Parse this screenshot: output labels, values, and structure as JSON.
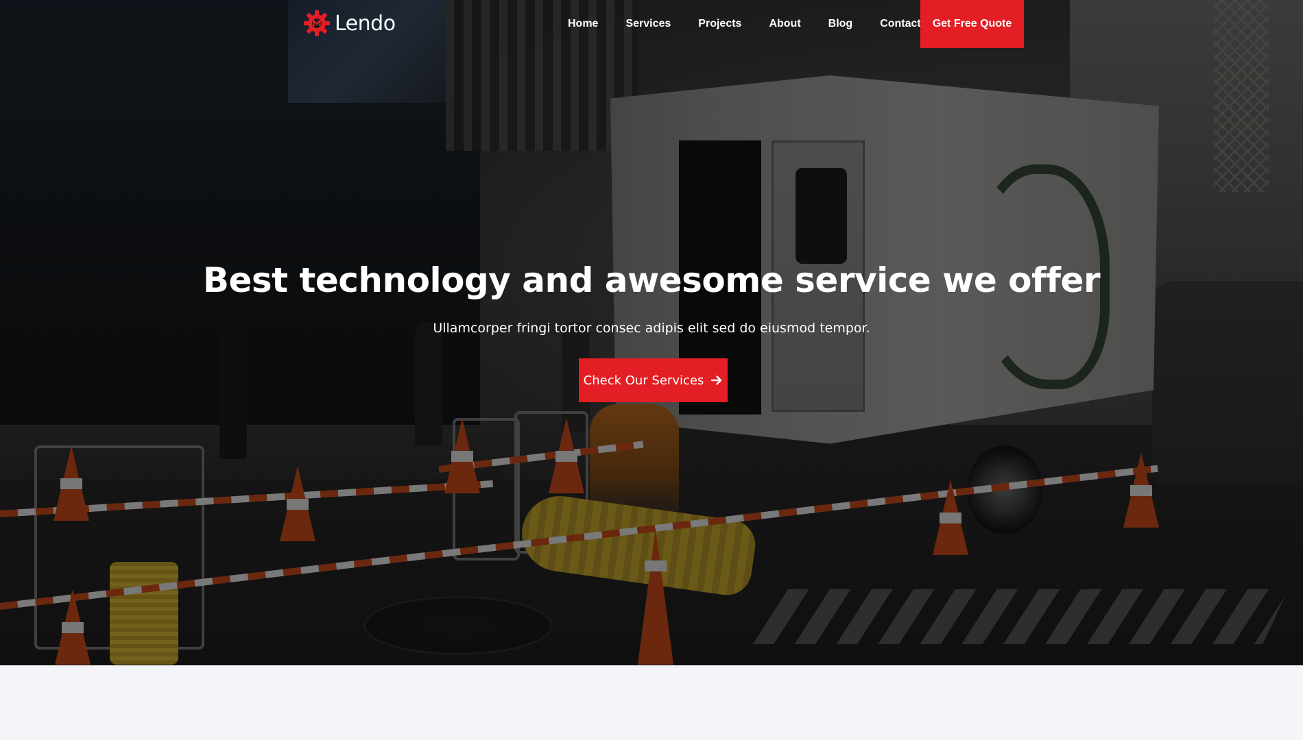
{
  "brand": {
    "name": "Lendo",
    "accent_color": "#e31e24",
    "logo_icon": "gear-icon"
  },
  "nav": {
    "items": [
      {
        "label": "Home"
      },
      {
        "label": "Services"
      },
      {
        "label": "Projects"
      },
      {
        "label": "About"
      },
      {
        "label": "Blog"
      },
      {
        "label": "Contact"
      }
    ],
    "quote_button": "Get Free Quote"
  },
  "hero": {
    "title": "Best technology and awesome service we offer",
    "subtitle": "Ullamcorper fringi tortor consec adipis elit sed do eiusmod tempor.",
    "cta_label": "Check Our Services",
    "cta_icon": "arrow-right-icon",
    "background_image": "street construction scene with utility truck, traffic cones and barriers"
  }
}
